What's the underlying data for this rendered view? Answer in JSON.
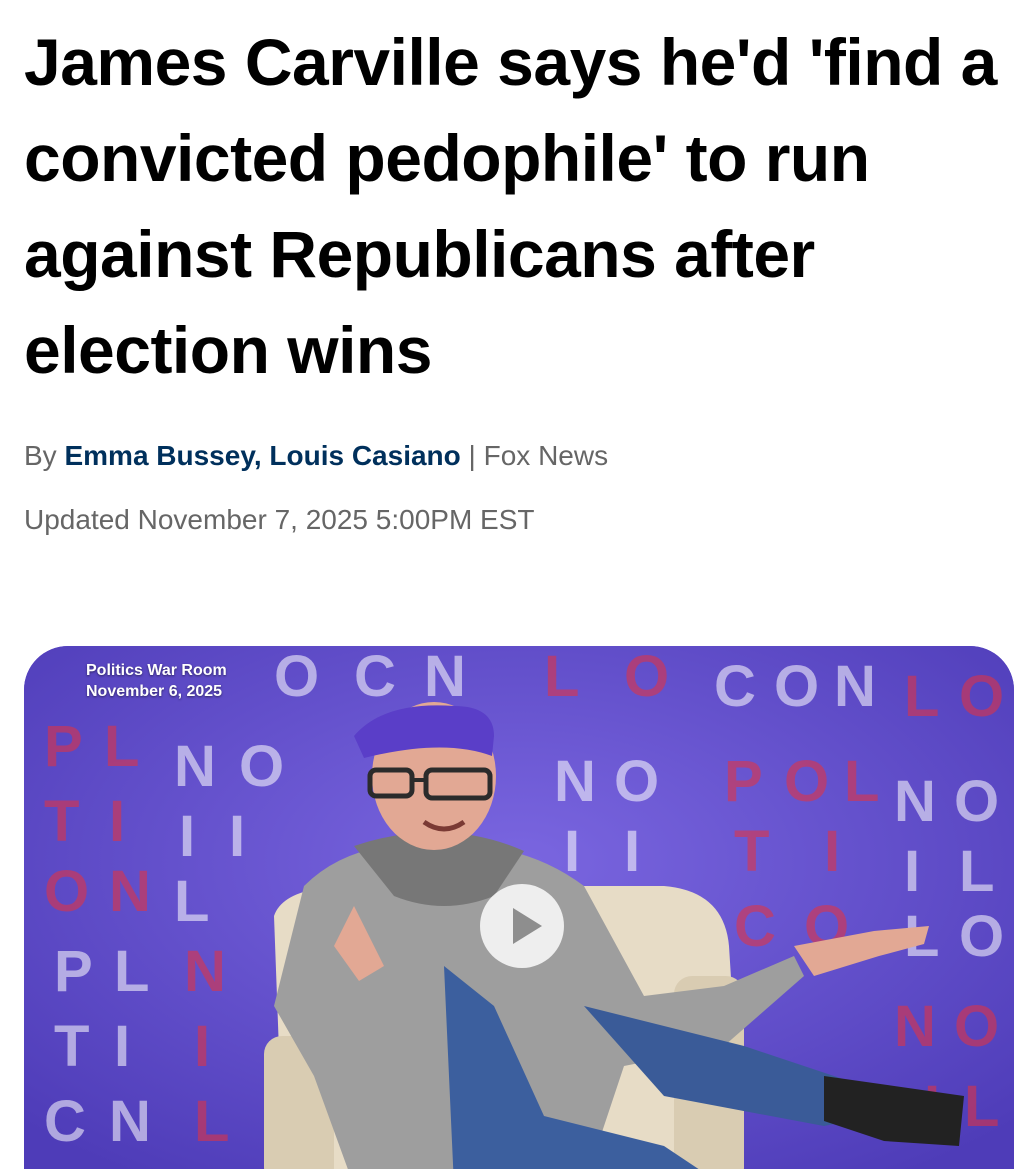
{
  "article": {
    "headline": "James Carville says he'd 'find a convicted pedophile' to run against Republicans after election wins",
    "by_label": "By",
    "authors": [
      "Emma Bussey",
      "Louis Casiano"
    ],
    "author_separator": ", ",
    "source_separator": "|",
    "source": "Fox News",
    "updated": "Updated November 7, 2025 5:00PM EST"
  },
  "video": {
    "overlay_title": "Politics War Room",
    "overlay_date": "November 6, 2025",
    "play_icon": "play-icon",
    "background_wordmark": "POLITICON",
    "backdrop_color": "#5c49c9",
    "accent_color": "#e8323c"
  },
  "colors": {
    "headline": "#000000",
    "author_link": "#00305c",
    "meta_text": "#666666"
  }
}
